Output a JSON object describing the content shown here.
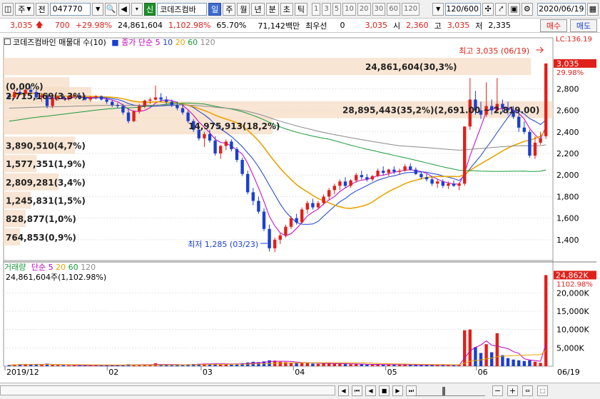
{
  "toolbar": {
    "market_label": "주",
    "prev_label": "전",
    "stock_code": "047770",
    "stock_name": "코데즈컴바",
    "credit_badge": "신",
    "periods": [
      {
        "label": "일",
        "active": true
      },
      {
        "label": "주",
        "active": false
      },
      {
        "label": "월",
        "active": false
      },
      {
        "label": "년",
        "active": false
      },
      {
        "label": "분",
        "active": false
      },
      {
        "label": "초",
        "active": false
      },
      {
        "label": "틱",
        "active": false
      }
    ],
    "intervals": [
      "1",
      "3",
      "5",
      "10",
      "20",
      "30",
      "60",
      "120"
    ],
    "count": "120/600",
    "date": "2020/06/19"
  },
  "quote": {
    "price": "3,035",
    "change": "700",
    "change_pct": "+29.98%",
    "volume": "24,861,604",
    "volume_ratio": "1,102.98%",
    "turnover_pct": "65.70%",
    "amount": "71,142백만",
    "best_label": "최우선",
    "best_value": "0",
    "best_price": "3,035",
    "open_label": "시",
    "open": "2,360",
    "high_label": "고",
    "high": "3,035",
    "low_label": "저",
    "low": "2,335",
    "buy_label": "매수",
    "sell_label": "매도"
  },
  "legend": {
    "price_title": "코데즈컴바인 매물대 수(10)",
    "ma_title": "종가 단순",
    "ma_periods": [
      "5",
      "10",
      "20",
      "60",
      "120"
    ],
    "vol_title": "거래량",
    "vol_ma_title": "단순",
    "vol_info": "24,861,604주(1,102.98%)"
  },
  "chart_data": {
    "type": "candlestick",
    "x_range": [
      "2019/12",
      "2020/06/19"
    ],
    "x_ticks": [
      "2019/12",
      "02",
      "03",
      "04",
      "05",
      "06",
      "06/19"
    ],
    "price_axis": {
      "ticks": [
        1400,
        1600,
        1800,
        2000,
        2200,
        2400,
        2600,
        2800
      ],
      "ylim": [
        1220,
        3180
      ],
      "top_label": "LC:136.19",
      "current_label": "3,035",
      "current_pct": "29.98%"
    },
    "volume_axis": {
      "ticks": [
        "5,000K",
        "10,000K",
        "15,000K",
        "20,000K"
      ],
      "tick_values": [
        5000,
        10000,
        15000,
        20000
      ],
      "ylim": [
        0,
        26500
      ],
      "current_label": "24,862K",
      "current_pct": "1102.98%"
    },
    "high_annotation": "최고 3,035 (06/19)",
    "low_annotation": "최저 1,285 (03/23)",
    "volume_profile": [
      {
        "label": "24,861,604(30,3%)",
        "price": 3000,
        "size": 0.96
      },
      {
        "label": "(0,00%)",
        "price": 2820,
        "size": 0.12
      },
      {
        "label": "2,715,169(3,3%)",
        "price": 2730,
        "size": 0.16
      },
      {
        "label": "28,895,443(35,2%)(2,691.00 ~ 2,819.00)",
        "price": 2600,
        "size": 1.0
      },
      {
        "label": "14,975,913(18,2%)",
        "price": 2450,
        "size": 0.49
      },
      {
        "label": "3,890,510(4,7%)",
        "price": 2270,
        "size": 0.13
      },
      {
        "label": "1,577,351(1,9%)",
        "price": 2100,
        "size": 0.06
      },
      {
        "label": "2,809,281(3,4%)",
        "price": 1930,
        "size": 0.1
      },
      {
        "label": "1,245,831(1,5%)",
        "price": 1760,
        "size": 0.05
      },
      {
        "label": "828,877(1,0%)",
        "price": 1590,
        "size": 0.04
      },
      {
        "label": "764,853(0,9%)",
        "price": 1420,
        "size": 0.03
      }
    ],
    "ma_series": [
      {
        "name": "5",
        "color": "#c000c0"
      },
      {
        "name": "10",
        "color": "#1a3fd1"
      },
      {
        "name": "20",
        "color": "#e8a400"
      },
      {
        "name": "60",
        "color": "#1a9a3a"
      },
      {
        "name": "120",
        "color": "#8a8a8a"
      }
    ],
    "candles_note": "sampled from screenshot",
    "candles": [
      [
        2740,
        2760,
        2700,
        2720,
        300
      ],
      [
        2720,
        2790,
        2710,
        2770,
        450
      ],
      [
        2770,
        2810,
        2740,
        2750,
        520
      ],
      [
        2750,
        2800,
        2730,
        2790,
        600
      ],
      [
        2790,
        2830,
        2760,
        2770,
        500
      ],
      [
        2770,
        2790,
        2700,
        2720,
        420
      ],
      [
        2720,
        2760,
        2680,
        2740,
        380
      ],
      [
        2740,
        2760,
        2620,
        2640,
        700
      ],
      [
        2640,
        2720,
        2620,
        2710,
        450
      ],
      [
        2710,
        2740,
        2690,
        2730,
        300
      ],
      [
        2730,
        2750,
        2700,
        2710,
        260
      ],
      [
        2710,
        2740,
        2690,
        2730,
        240
      ],
      [
        2730,
        2760,
        2710,
        2740,
        230
      ],
      [
        2740,
        2760,
        2710,
        2720,
        220
      ],
      [
        2720,
        2740,
        2690,
        2700,
        250
      ],
      [
        2700,
        2730,
        2680,
        2720,
        240
      ],
      [
        2720,
        2740,
        2700,
        2730,
        200
      ],
      [
        2730,
        2740,
        2690,
        2700,
        220
      ],
      [
        2700,
        2720,
        2660,
        2680,
        260
      ],
      [
        2680,
        2700,
        2630,
        2650,
        300
      ],
      [
        2650,
        2670,
        2620,
        2640,
        280
      ],
      [
        2640,
        2660,
        2560,
        2580,
        360
      ],
      [
        2580,
        2620,
        2480,
        2500,
        520
      ],
      [
        2500,
        2600,
        2490,
        2590,
        400
      ],
      [
        2590,
        2660,
        2570,
        2640,
        380
      ],
      [
        2640,
        2700,
        2620,
        2690,
        420
      ],
      [
        2690,
        2720,
        2660,
        2700,
        360
      ],
      [
        2700,
        2830,
        2690,
        2720,
        800
      ],
      [
        2720,
        2760,
        2680,
        2700,
        420
      ],
      [
        2700,
        2730,
        2660,
        2680,
        350
      ],
      [
        2680,
        2700,
        2630,
        2650,
        320
      ],
      [
        2650,
        2680,
        2600,
        2620,
        360
      ],
      [
        2620,
        2660,
        2560,
        2580,
        420
      ],
      [
        2580,
        2600,
        2480,
        2500,
        520
      ],
      [
        2500,
        2520,
        2400,
        2420,
        600
      ],
      [
        2420,
        2460,
        2320,
        2340,
        640
      ],
      [
        2340,
        2400,
        2260,
        2380,
        700
      ],
      [
        2380,
        2420,
        2300,
        2320,
        560
      ],
      [
        2320,
        2360,
        2180,
        2200,
        700
      ],
      [
        2200,
        2280,
        2150,
        2270,
        620
      ],
      [
        2270,
        2330,
        2230,
        2310,
        520
      ],
      [
        2310,
        2330,
        2220,
        2240,
        540
      ],
      [
        2240,
        2260,
        2120,
        2140,
        640
      ],
      [
        2140,
        2160,
        1990,
        2010,
        800
      ],
      [
        2010,
        2040,
        1820,
        1840,
        1000
      ],
      [
        1840,
        1880,
        1720,
        1760,
        1200
      ],
      [
        1760,
        1800,
        1640,
        1660,
        1100
      ],
      [
        1660,
        1690,
        1480,
        1500,
        1300
      ],
      [
        1500,
        1540,
        1290,
        1320,
        1600
      ],
      [
        1320,
        1420,
        1285,
        1400,
        1500
      ],
      [
        1400,
        1460,
        1360,
        1440,
        1200
      ],
      [
        1440,
        1540,
        1420,
        1520,
        1100
      ],
      [
        1520,
        1620,
        1500,
        1600,
        1000
      ],
      [
        1600,
        1640,
        1540,
        1560,
        800
      ],
      [
        1560,
        1700,
        1550,
        1680,
        900
      ],
      [
        1680,
        1760,
        1640,
        1740,
        950
      ],
      [
        1740,
        1780,
        1680,
        1700,
        700
      ],
      [
        1700,
        1760,
        1680,
        1740,
        620
      ],
      [
        1740,
        1820,
        1720,
        1800,
        700
      ],
      [
        1800,
        1880,
        1770,
        1860,
        800
      ],
      [
        1860,
        1920,
        1820,
        1900,
        700
      ],
      [
        1900,
        1960,
        1860,
        1940,
        650
      ],
      [
        1940,
        1980,
        1880,
        1900,
        560
      ],
      [
        1900,
        1960,
        1880,
        1950,
        520
      ],
      [
        1950,
        2020,
        1930,
        2000,
        600
      ],
      [
        2000,
        2040,
        1960,
        1980,
        480
      ],
      [
        1980,
        2010,
        1940,
        1960,
        420
      ],
      [
        1960,
        2000,
        1940,
        1990,
        400
      ],
      [
        1990,
        2060,
        1980,
        2040,
        500
      ],
      [
        2040,
        2080,
        2000,
        2020,
        440
      ],
      [
        2020,
        2060,
        1990,
        2050,
        420
      ],
      [
        2050,
        2080,
        2010,
        2030,
        380
      ],
      [
        2030,
        2060,
        2000,
        2040,
        360
      ],
      [
        2040,
        2100,
        2030,
        2080,
        420
      ],
      [
        2080,
        2110,
        2040,
        2050,
        400
      ],
      [
        2050,
        2070,
        2000,
        2010,
        360
      ],
      [
        2010,
        2030,
        1960,
        1980,
        340
      ],
      [
        1980,
        2010,
        1940,
        1960,
        320
      ],
      [
        1960,
        1990,
        1900,
        1920,
        340
      ],
      [
        1920,
        1960,
        1880,
        1940,
        320
      ],
      [
        1940,
        1960,
        1880,
        1900,
        300
      ],
      [
        1900,
        1940,
        1870,
        1920,
        300
      ],
      [
        1920,
        1950,
        1890,
        1900,
        280
      ],
      [
        1900,
        1930,
        1860,
        1920,
        300
      ],
      [
        1920,
        2450,
        1900,
        2450,
        9800
      ],
      [
        2450,
        2900,
        2420,
        2700,
        10000
      ],
      [
        2700,
        2780,
        2560,
        2600,
        5200
      ],
      [
        2600,
        2680,
        2520,
        2560,
        3600
      ],
      [
        2560,
        2860,
        2540,
        2640,
        6000
      ],
      [
        2640,
        2700,
        2560,
        2600,
        3800
      ],
      [
        2600,
        2900,
        2580,
        2660,
        9000
      ],
      [
        2660,
        2700,
        2580,
        2620,
        3000
      ],
      [
        2620,
        2680,
        2560,
        2600,
        2200
      ],
      [
        2600,
        2640,
        2520,
        2540,
        1800
      ],
      [
        2540,
        2580,
        2400,
        2440,
        1600
      ],
      [
        2440,
        2500,
        2380,
        2400,
        1400
      ],
      [
        2400,
        2420,
        2160,
        2180,
        1600
      ],
      [
        2180,
        2360,
        2150,
        2300,
        1200
      ],
      [
        2300,
        2400,
        2280,
        2340,
        900
      ],
      [
        2360,
        3035,
        2335,
        3035,
        24861
      ]
    ]
  }
}
